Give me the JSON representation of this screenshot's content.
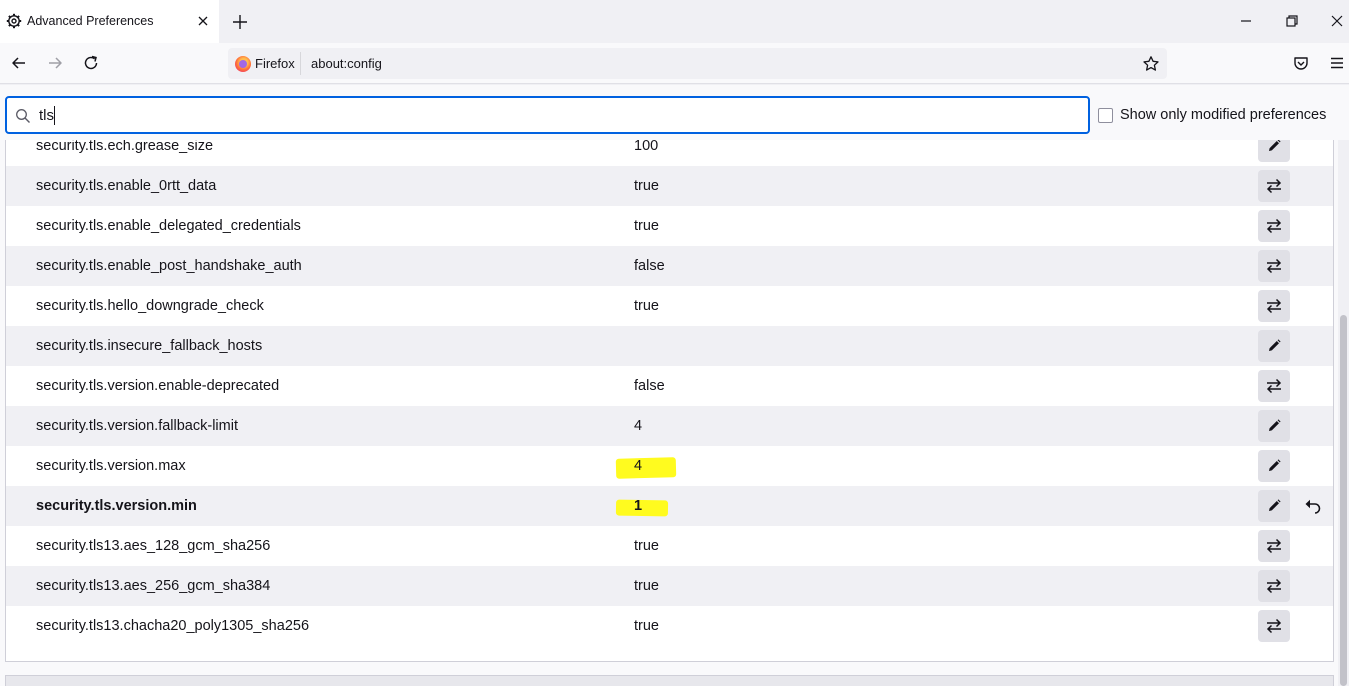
{
  "tab": {
    "title": "Advanced Preferences"
  },
  "urlbar": {
    "identity": "Firefox",
    "url": "about:config"
  },
  "search": {
    "value": "tls"
  },
  "filter": {
    "label": "Show only modified preferences",
    "checked": false
  },
  "colors": {
    "accent": "#0061e0",
    "highlight": "#fffb1f",
    "row_alt": "#f0f0f4"
  },
  "prefs": [
    {
      "name": "security.tls.ech.grease_size",
      "value": "100",
      "action": "edit"
    },
    {
      "name": "security.tls.enable_0rtt_data",
      "value": "true",
      "action": "toggle"
    },
    {
      "name": "security.tls.enable_delegated_credentials",
      "value": "true",
      "action": "toggle"
    },
    {
      "name": "security.tls.enable_post_handshake_auth",
      "value": "false",
      "action": "toggle"
    },
    {
      "name": "security.tls.hello_downgrade_check",
      "value": "true",
      "action": "toggle"
    },
    {
      "name": "security.tls.insecure_fallback_hosts",
      "value": "",
      "action": "edit"
    },
    {
      "name": "security.tls.version.enable-deprecated",
      "value": "false",
      "action": "toggle"
    },
    {
      "name": "security.tls.version.fallback-limit",
      "value": "4",
      "action": "edit"
    },
    {
      "name": "security.tls.version.max",
      "value": "4",
      "action": "edit",
      "highlighted": true
    },
    {
      "name": "security.tls.version.min",
      "value": "1",
      "action": "edit",
      "highlighted": true,
      "modified": true
    },
    {
      "name": "security.tls13.aes_128_gcm_sha256",
      "value": "true",
      "action": "toggle"
    },
    {
      "name": "security.tls13.aes_256_gcm_sha384",
      "value": "true",
      "action": "toggle"
    },
    {
      "name": "security.tls13.chacha20_poly1305_sha256",
      "value": "true",
      "action": "toggle"
    }
  ],
  "icons": {
    "tab": "gear-icon",
    "close": "close-icon",
    "new_tab": "plus-icon",
    "back": "back-arrow-icon",
    "forward": "forward-arrow-icon",
    "reload": "reload-icon",
    "bookmark": "star-icon",
    "pocket": "pocket-icon",
    "menu": "hamburger-menu-icon",
    "search": "search-icon",
    "edit": "pencil-icon",
    "toggle": "toggle-arrows-icon",
    "reset": "undo-icon"
  }
}
